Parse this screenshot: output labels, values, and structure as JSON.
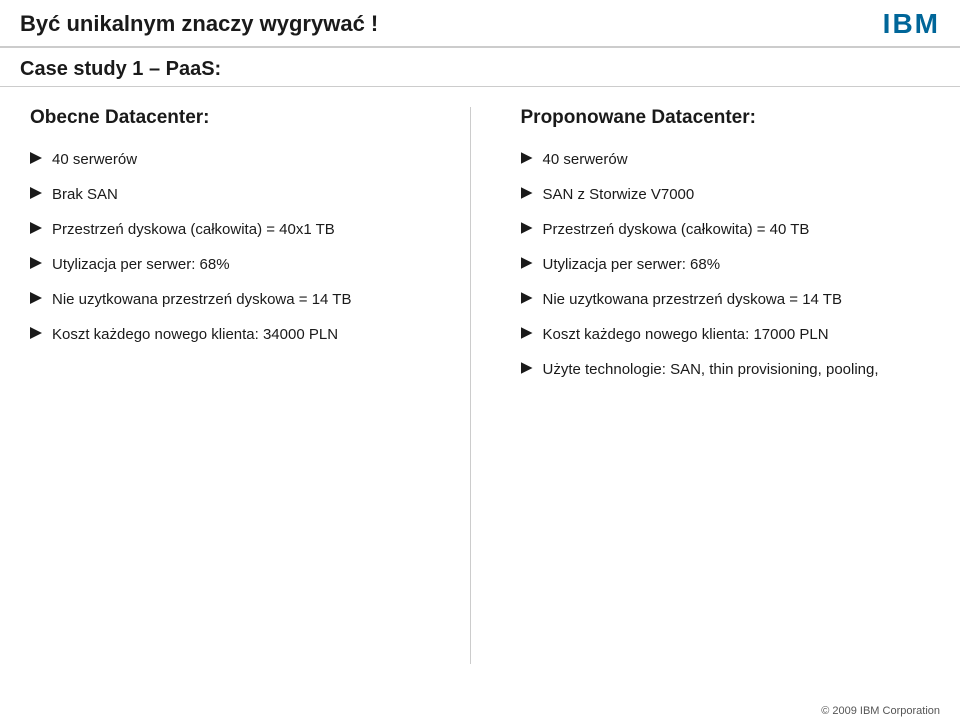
{
  "header": {
    "title": "Być unikalnym znaczy wygrywać !",
    "ibm_logo_text": "IBM"
  },
  "subheader": {
    "title": "Case study 1 – PaaS:"
  },
  "left_column": {
    "heading": "Obecne Datacenter:",
    "bullets": [
      "40 serwerów",
      "Brak SAN",
      "Przestrzeń dyskowa (całkowita) = 40x1 TB",
      "Utylizacja per serwer: 68%",
      "Nie uzytkowana przestrzeń dyskowa = 14 TB",
      "Koszt każdego nowego klienta: 34000 PLN"
    ]
  },
  "right_column": {
    "heading": "Proponowane Datacenter:",
    "bullets": [
      "40 serwerów",
      "SAN z Storwize V7000",
      "Przestrzeń dyskowa (całkowita) = 40 TB",
      "Utylizacja per serwer: 68%",
      "Nie uzytkowana przestrzeń dyskowa = 14 TB",
      "Koszt każdego nowego klienta: 17000 PLN",
      "Użyte technologie: SAN, thin provisioning, pooling,"
    ]
  },
  "footer": {
    "text": "© 2009 IBM Corporation"
  }
}
